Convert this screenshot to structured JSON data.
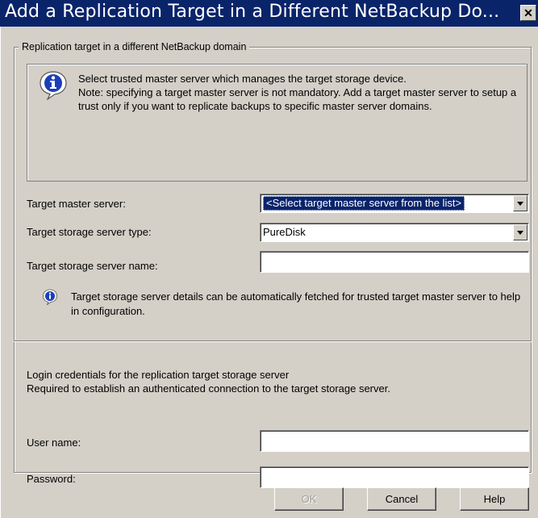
{
  "window": {
    "title": "Add a Replication Target in a Different NetBackup Do...",
    "close_glyph": "✕"
  },
  "group": {
    "legend": "Replication target in a different NetBackup domain"
  },
  "info": {
    "icon": "info-icon",
    "line1": "Select trusted master server which manages the target storage device.",
    "line2": "Note: specifying a target master server is not mandatory. Add a target master server to setup a trust only if you want to replicate backups to specific master server domains."
  },
  "fields": {
    "target_master_label": "Target master server:",
    "target_master_value": "<Select target master server from the list>",
    "storage_type_label": "Target storage server type:",
    "storage_type_value": "PureDisk",
    "storage_name_label": "Target storage server name:",
    "storage_name_value": ""
  },
  "note": {
    "icon": "info-small-icon",
    "text": "Target storage server details can be automatically fetched for trusted target master server to help in configuration."
  },
  "credentials": {
    "heading": "Login credentials for the replication target storage server",
    "subheading": "Required to establish an authenticated connection to the target storage server.",
    "username_label": "User name:",
    "username_value": "",
    "password_label": "Password:",
    "password_value": ""
  },
  "buttons": {
    "ok": "OK",
    "cancel": "Cancel",
    "help": "Help"
  },
  "colors": {
    "titlebar": "#0a246a",
    "dialog_bg": "#d4d0c8",
    "selection": "#0a246a"
  }
}
